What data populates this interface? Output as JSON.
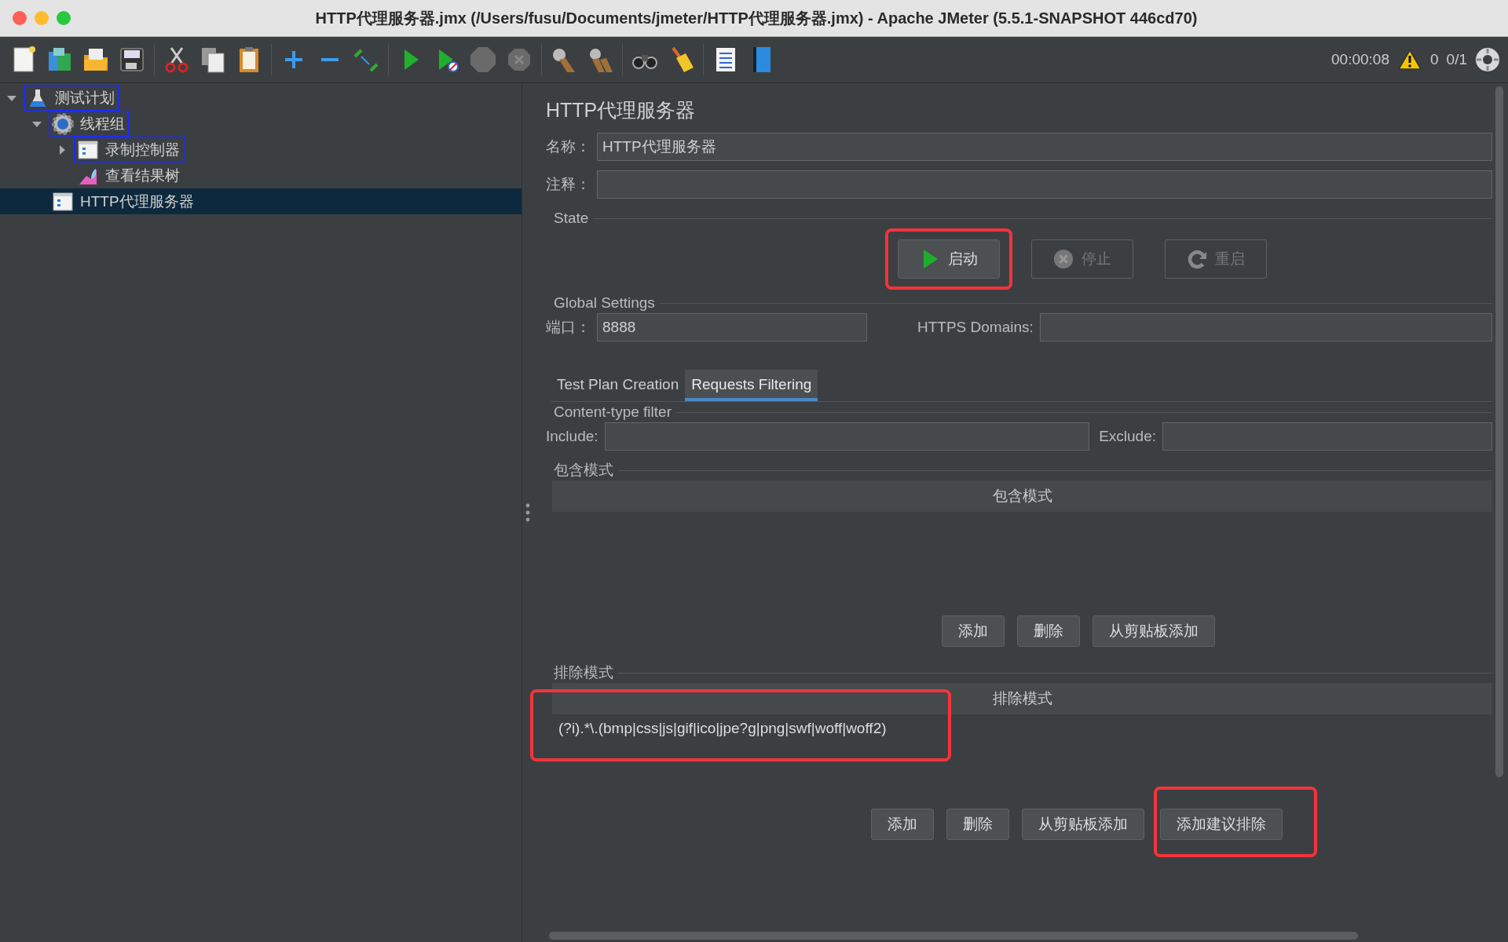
{
  "window": {
    "title": "HTTP代理服务器.jmx (/Users/fusu/Documents/jmeter/HTTP代理服务器.jmx) - Apache JMeter (5.5.1-SNAPSHOT 446cd70)"
  },
  "toolbar_status": {
    "elapsed": "00:00:08",
    "warnings": "0",
    "threads": "0/1"
  },
  "tree": [
    {
      "label": "测试计划",
      "kind": "test-plan",
      "expanded": true,
      "search_match": true,
      "selected": false,
      "children": [
        {
          "label": "线程组",
          "kind": "thread-group",
          "expanded": true,
          "search_match": true,
          "selected": false,
          "children": [
            {
              "label": "录制控制器",
              "kind": "controller",
              "expanded": false,
              "search_match": true,
              "selected": false
            },
            {
              "label": "查看结果树",
              "kind": "listener",
              "search_match": false,
              "selected": false
            }
          ]
        },
        {
          "label": "HTTP代理服务器",
          "kind": "controller",
          "search_match": false,
          "selected": true
        }
      ]
    }
  ],
  "editor": {
    "title": "HTTP代理服务器",
    "name_label": "名称：",
    "name_value": "HTTP代理服务器",
    "comment_label": "注释：",
    "state": {
      "legend": "State",
      "buttons": [
        {
          "label": "启动",
          "kind": "start",
          "disabled": false,
          "highlighted": true
        },
        {
          "label": "停止",
          "kind": "stop",
          "disabled": true,
          "highlighted": false
        },
        {
          "label": "重启",
          "kind": "restart",
          "disabled": true,
          "highlighted": false
        }
      ]
    },
    "global": {
      "legend": "Global Settings",
      "port_label": "端口：",
      "port_value": "8888",
      "https_label": "HTTPS Domains:"
    },
    "tabs": [
      {
        "label": "Test Plan Creation",
        "selected": false
      },
      {
        "label": "Requests Filtering",
        "selected": true
      }
    ],
    "content_filter": {
      "legend": "Content-type filter",
      "include_label": "Include:",
      "exclude_label": "Exclude:"
    },
    "include": {
      "legend": "包含模式",
      "header": "包含模式",
      "buttons": [
        {
          "label": "添加",
          "highlighted": false
        },
        {
          "label": "删除",
          "highlighted": false
        },
        {
          "label": "从剪贴板添加",
          "highlighted": false
        }
      ]
    },
    "exclude": {
      "legend": "排除模式",
      "header": "排除模式",
      "rows": [
        {
          "text": "(?i).*\\.(bmp|css|js|gif|ico|jpe?g|png|swf|woff|woff2)",
          "highlighted": true
        }
      ],
      "buttons": [
        {
          "label": "添加",
          "highlighted": false
        },
        {
          "label": "删除",
          "highlighted": false
        },
        {
          "label": "从剪贴板添加",
          "highlighted": false
        },
        {
          "label": "添加建议排除",
          "highlighted": true
        }
      ]
    }
  }
}
